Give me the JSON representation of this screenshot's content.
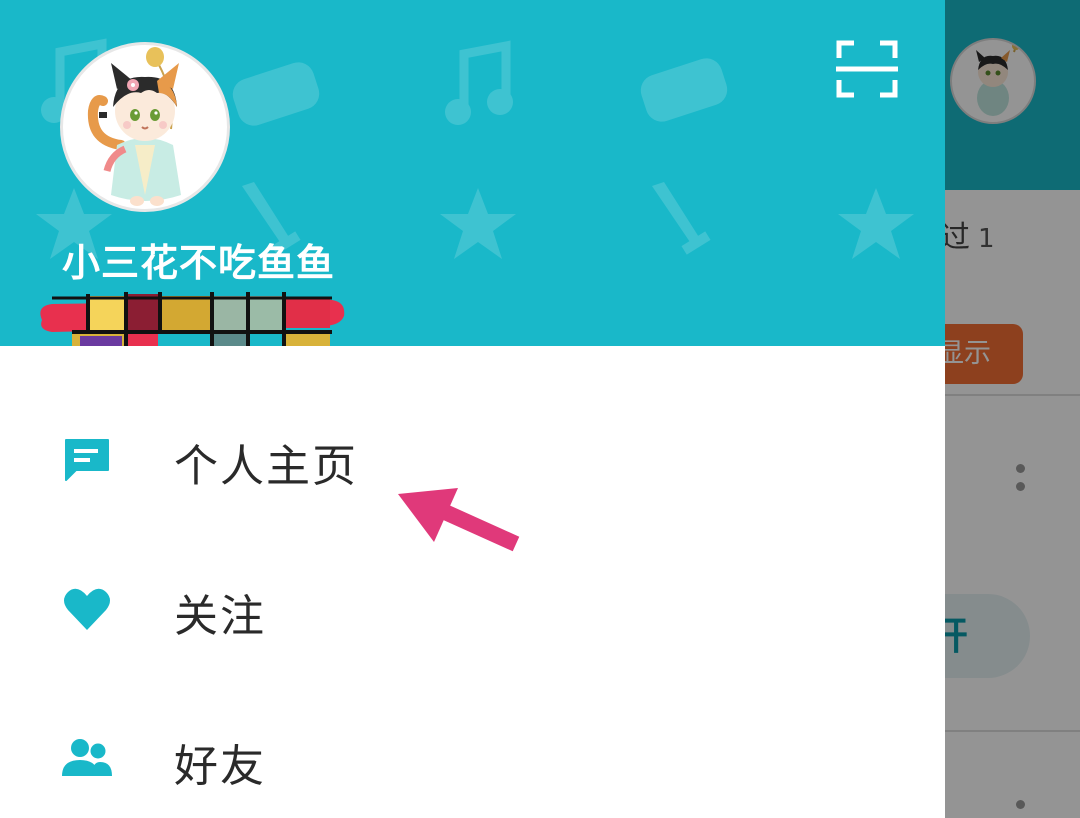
{
  "profile": {
    "username": "小三花不吃鱼鱼"
  },
  "header": {
    "scan_icon": "scan-icon"
  },
  "menu": {
    "items": [
      {
        "label": "个人主页",
        "icon": "profile-page-icon"
      },
      {
        "label": "关注",
        "icon": "heart-icon"
      },
      {
        "label": "好友",
        "icon": "friends-icon"
      }
    ]
  },
  "background": {
    "count_text": "过",
    "count_value": "1",
    "show_button": "显示",
    "open_button": "开"
  },
  "colors": {
    "accent": "#19b8c9",
    "show_button": "#f36f34",
    "annotation_arrow": "#e0397a"
  }
}
